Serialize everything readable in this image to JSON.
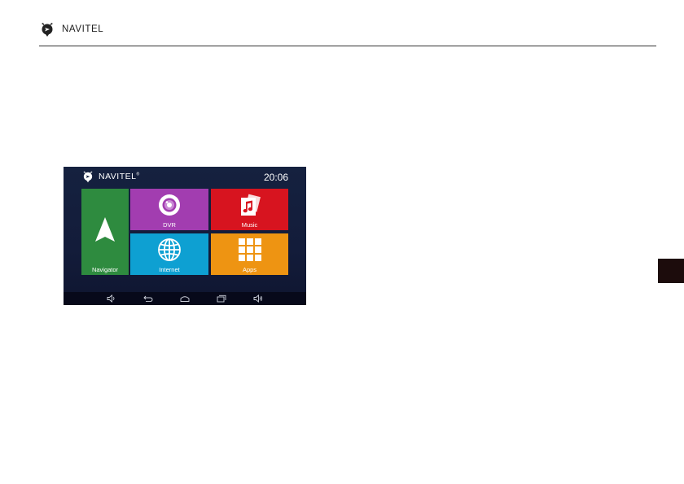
{
  "page_header": {
    "brand": "NAVITEL",
    "logo_icon": "navitel-pin-logo-icon"
  },
  "device": {
    "brand": "NAVITEL",
    "brand_mark": "®",
    "time": "20:06",
    "colors": {
      "background": "#14203e",
      "navigator": "#2e8b3f",
      "dvr": "#a23db0",
      "music": "#d7141f",
      "internet": "#0ea0d2",
      "apps": "#ee9412"
    },
    "tiles": [
      {
        "id": "navigator",
        "label": "Navigator",
        "icon": "navigation-arrow-icon"
      },
      {
        "id": "dvr",
        "label": "DVR",
        "icon": "camera-lens-icon"
      },
      {
        "id": "music",
        "label": "Music",
        "icon": "music-note-icon"
      },
      {
        "id": "internet",
        "label": "Internet",
        "icon": "globe-icon"
      },
      {
        "id": "apps",
        "label": "Apps",
        "icon": "apps-grid-icon"
      }
    ],
    "nav_bar": [
      "volume-down-icon",
      "back-icon",
      "home-icon",
      "recent-apps-icon",
      "volume-up-icon"
    ]
  }
}
